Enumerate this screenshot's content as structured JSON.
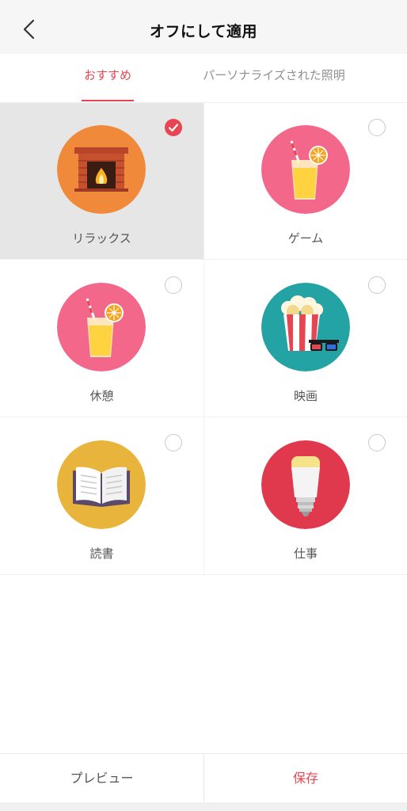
{
  "header": {
    "title": "オフにして適用",
    "back_icon": "chevron-left-icon"
  },
  "tabs": [
    {
      "label": "おすすめ",
      "active": true
    },
    {
      "label": "パーソナライズされた照明",
      "active": false
    }
  ],
  "scenes": [
    {
      "label": "リラックス",
      "icon": "fireplace-icon",
      "selected": true,
      "circle_color": "#f08a3a"
    },
    {
      "label": "ゲーム",
      "icon": "juice-icon",
      "selected": false,
      "circle_color": "#f3678a"
    },
    {
      "label": "休憩",
      "icon": "juice-icon",
      "selected": false,
      "circle_color": "#f3678a"
    },
    {
      "label": "映画",
      "icon": "popcorn-3d-glasses-icon",
      "selected": false,
      "circle_color": "#24a3a5"
    },
    {
      "label": "読書",
      "icon": "open-book-icon",
      "selected": false,
      "circle_color": "#e9b43b"
    },
    {
      "label": "仕事",
      "icon": "smart-bulb-icon",
      "selected": false,
      "circle_color": "#e0394d"
    }
  ],
  "footer": {
    "preview_label": "プレビュー",
    "save_label": "保存"
  },
  "colors": {
    "accent": "#e84552",
    "selected_bg": "#e6e6e6"
  }
}
